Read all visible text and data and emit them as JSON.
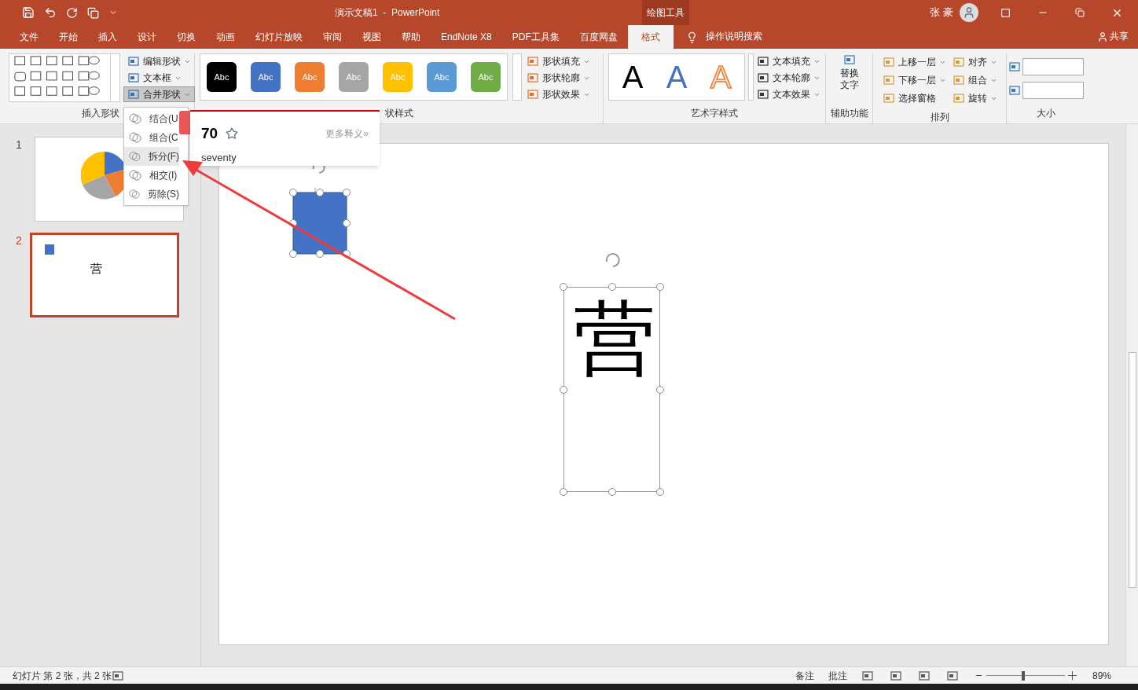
{
  "window": {
    "title": "演示文稿1  -  PowerPoint",
    "context_tab": "绘图工具",
    "user": "张 豪"
  },
  "tabs": [
    {
      "label": "文件",
      "selected": false
    },
    {
      "label": "开始",
      "selected": false
    },
    {
      "label": "插入",
      "selected": false
    },
    {
      "label": "设计",
      "selected": false
    },
    {
      "label": "切换",
      "selected": false
    },
    {
      "label": "动画",
      "selected": false
    },
    {
      "label": "幻灯片放映",
      "selected": false
    },
    {
      "label": "审阅",
      "selected": false
    },
    {
      "label": "视图",
      "selected": false
    },
    {
      "label": "帮助",
      "selected": false
    },
    {
      "label": "EndNote X8",
      "selected": false
    },
    {
      "label": "PDF工具集",
      "selected": false
    },
    {
      "label": "百度网盘",
      "selected": false
    },
    {
      "label": "格式",
      "selected": true
    }
  ],
  "tell_me": "操作说明搜索",
  "share": "共享",
  "insert_shapes": {
    "label": "插入形状",
    "commands": [
      {
        "label": "编辑形状",
        "expanded": false
      },
      {
        "label": "文本框",
        "expanded": false
      },
      {
        "label": "合并形状",
        "expanded": true
      }
    ]
  },
  "shape_styles": {
    "label": "状样式",
    "swatches": [
      {
        "text": "Abc",
        "color": "#000000"
      },
      {
        "text": "Abc",
        "color": "#4472c4"
      },
      {
        "text": "Abc",
        "color": "#ed7d31"
      },
      {
        "text": "Abc",
        "color": "#a5a5a5"
      },
      {
        "text": "Abc",
        "color": "#ffc000"
      },
      {
        "text": "Abc",
        "color": "#5b9bd5"
      },
      {
        "text": "Abc",
        "color": "#70ad47"
      }
    ],
    "commands": [
      "形状填充",
      "形状轮廓",
      "形状效果"
    ]
  },
  "wordart": {
    "label": "艺术字样式",
    "samples": [
      {
        "text": "A",
        "kind": "solid"
      },
      {
        "text": "A",
        "kind": "blue"
      },
      {
        "text": "A",
        "kind": "outline"
      }
    ],
    "commands": [
      "文本填充",
      "文本轮廓",
      "文本效果"
    ]
  },
  "accessibility": {
    "label": "辅助功能",
    "button": "替换文字"
  },
  "arrange": {
    "label": "排列",
    "commands": [
      "上移一层",
      "下移一层",
      "选择窗格",
      "对齐",
      "组合",
      "旋转"
    ]
  },
  "size": {
    "label": "大小"
  },
  "merge_menu": {
    "items": [
      {
        "label": "结合(U",
        "selected": false
      },
      {
        "label": "组合(C",
        "selected": false
      },
      {
        "label": "拆分(F)",
        "selected": true
      },
      {
        "label": "相交(I)",
        "selected": false
      },
      {
        "label": "剪除(S)",
        "selected": false
      }
    ]
  },
  "dictionary_popup": {
    "word": "70",
    "more": "更多释义»",
    "meaning": "seventy"
  },
  "slides": [
    {
      "number": "1",
      "selected": false,
      "kind": "chart"
    },
    {
      "number": "2",
      "selected": true,
      "kind": "shapes",
      "text": "营"
    }
  ],
  "canvas": {
    "text": "营"
  },
  "status_bar": {
    "slide_info": "幻灯片 第 2 张，共 2 张",
    "notes": "备注",
    "comments": "批注",
    "zoom": {
      "level": 0.45,
      "reading": "89%"
    }
  }
}
